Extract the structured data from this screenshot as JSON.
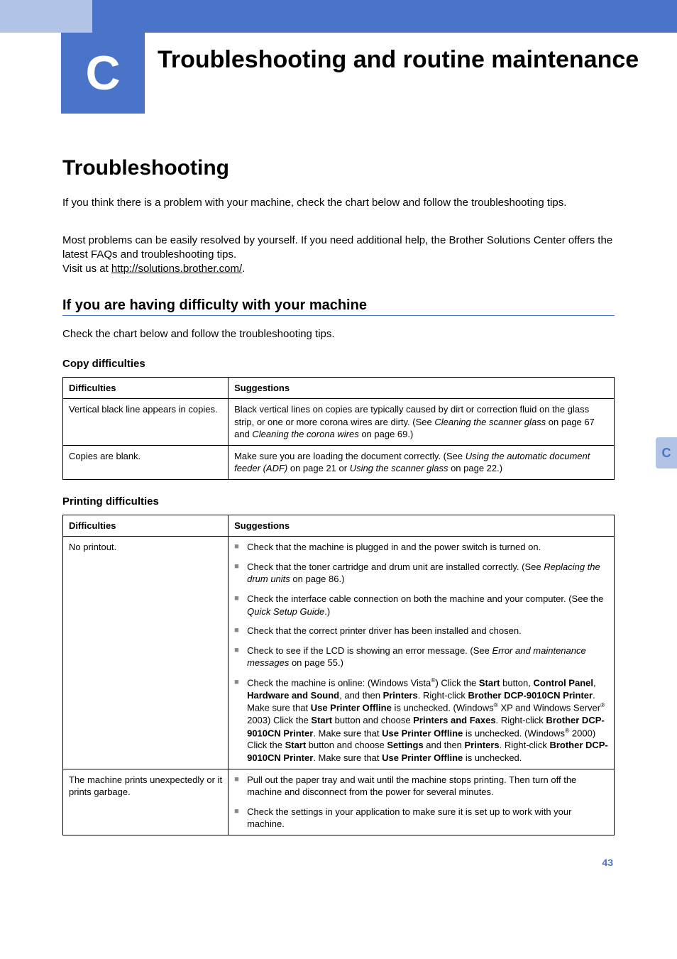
{
  "chapter": {
    "badge": "C",
    "title": "Troubleshooting and routine maintenance"
  },
  "section": {
    "h1": "Troubleshooting",
    "intro1": "If you think there is a problem with your machine, check the chart below and follow the troubleshooting tips.",
    "intro2_pre": "Most problems can be easily resolved by yourself. If you need additional help, the Brother Solutions Center offers the latest FAQs and troubleshooting tips.\nVisit us at ",
    "intro2_link": "http://solutions.brother.com/",
    "intro2_post": ".",
    "h2": "If you are having difficulty with your machine",
    "h2_sub": "Check the chart below and follow the troubleshooting tips."
  },
  "tables": {
    "copy": {
      "heading": "Copy difficulties",
      "head_diff": "Difficulties",
      "head_sugg": "Suggestions",
      "rows": [
        {
          "diff": "Vertical black line appears in copies.",
          "sugg_pre": "Black vertical lines on copies are typically caused by dirt or correction fluid on the glass strip, or one or more corona wires are dirty. (See ",
          "sugg_i1": "Cleaning the scanner glass",
          "sugg_mid": " on page 67 and ",
          "sugg_i2": "Cleaning the corona wires",
          "sugg_post": " on page 69.)"
        },
        {
          "diff": "Copies are blank.",
          "sugg_pre": "Make sure you are loading the document correctly. (See ",
          "sugg_i1": "Using the automatic document feeder (ADF)",
          "sugg_mid": " on page 21 or ",
          "sugg_i2": "Using the scanner glass",
          "sugg_post": " on page 22.)"
        }
      ]
    },
    "print": {
      "heading": "Printing difficulties",
      "head_diff": "Difficulties",
      "head_sugg": "Suggestions",
      "row1_diff": "No printout.",
      "row1_items": {
        "b1": "Check that the machine is plugged in and the power switch is turned on.",
        "b2_pre": "Check that the toner cartridge and drum unit are installed correctly. (See ",
        "b2_i": "Replacing the drum units",
        "b2_post": " on page 86.)",
        "b3_pre": "Check the interface cable connection on both the machine and your computer. (See the ",
        "b3_i": "Quick Setup Guide",
        "b3_post": ".)",
        "b4": "Check that the correct printer driver has been installed and chosen.",
        "b5_pre": "Check to see if the LCD is showing an error message. (See ",
        "b5_i": "Error and maintenance messages",
        "b5_post": " on page 55.)",
        "b6_p1": "Check the machine is online: (Windows Vista",
        "b6_reg": "®",
        "b6_p2": ") Click the ",
        "b6_b1": "Start",
        "b6_p3": " button, ",
        "b6_b2": "Control Panel",
        "b6_p4": ", ",
        "b6_b3": "Hardware and Sound",
        "b6_p5": ", and then ",
        "b6_b4": "Printers",
        "b6_p6": ". Right-click ",
        "b6_b5": "Brother DCP-9010CN Printer",
        "b6_p7": ". Make sure that ",
        "b6_b6": "Use Printer Offline",
        "b6_p8": " is unchecked. (Windows",
        "b6_p9": " XP and Windows Server",
        "b6_p10": " 2003) Click the ",
        "b6_b7": "Start",
        "b6_p11": " button and choose ",
        "b6_b8": "Printers and Faxes",
        "b6_p12": ". Right-click ",
        "b6_b9": "Brother DCP-9010CN Printer",
        "b6_p13": ". Make sure that ",
        "b6_b10": "Use Printer Offline",
        "b6_p14": " is unchecked. (Windows",
        "b6_p15": " 2000) Click the ",
        "b6_b11": "Start",
        "b6_p16": " button and choose ",
        "b6_b12": "Settings",
        "b6_p17": " and then ",
        "b6_b13": "Printers",
        "b6_p18": ". Right-click ",
        "b6_b14": "Brother DCP-9010CN Printer",
        "b6_p19": ". Make sure that ",
        "b6_b15": "Use Printer Offline",
        "b6_p20": " is unchecked."
      },
      "row2_diff": "The machine prints unexpectedly or it prints garbage.",
      "row2_items": {
        "b1": "Pull out the paper tray and wait until the machine stops printing. Then turn off the machine and disconnect from the power for several minutes.",
        "b2": "Check the settings in your application to make sure it is set up to work with your machine."
      }
    }
  },
  "side_tab": "C",
  "page_number": "43"
}
